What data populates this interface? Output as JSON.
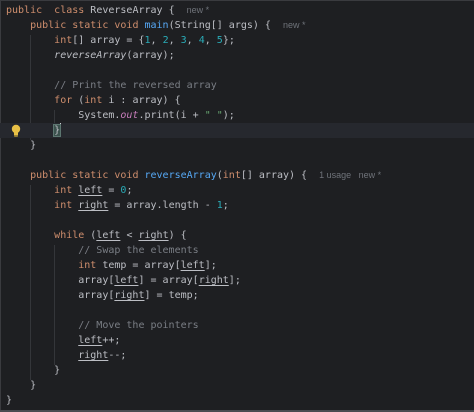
{
  "editor": {
    "background": "#1e1f22",
    "lines": [
      [
        [
          "kw",
          "public"
        ],
        [
          "",
          "  "
        ],
        [
          "kw",
          "class"
        ],
        [
          "",
          " ReverseArray {  "
        ],
        [
          "hint",
          "new *"
        ]
      ],
      [
        [
          "",
          "    "
        ],
        [
          "kw",
          "public static void"
        ],
        [
          "",
          " "
        ],
        [
          "fn",
          "main"
        ],
        [
          "",
          "(String[] args) {  "
        ],
        [
          "hint",
          "new *"
        ]
      ],
      [
        [
          "",
          "        "
        ],
        [
          "kw",
          "int"
        ],
        [
          "",
          "[] array = {"
        ],
        [
          "num",
          "1"
        ],
        [
          ", ",
          ", "
        ],
        [
          "num",
          "2"
        ],
        [
          ", ",
          ", "
        ],
        [
          "num",
          "3"
        ],
        [
          ", ",
          ", "
        ],
        [
          "num",
          "4"
        ],
        [
          ", ",
          ", "
        ],
        [
          "num",
          "5"
        ],
        [
          "",
          "};"
        ]
      ],
      [
        [
          "",
          "        "
        ],
        [
          "it",
          "reverseArray"
        ],
        [
          "",
          "(array);"
        ]
      ],
      [
        [
          "",
          ""
        ]
      ],
      [
        [
          "",
          "        "
        ],
        [
          "cm",
          "// Print the reversed array"
        ]
      ],
      [
        [
          "",
          "        "
        ],
        [
          "kw",
          "for"
        ],
        [
          "",
          " ("
        ],
        [
          "kw",
          "int"
        ],
        [
          "",
          " i : array) {"
        ]
      ],
      [
        [
          "",
          "            System."
        ],
        [
          "st",
          "out"
        ],
        [
          "",
          ".print(i + "
        ],
        [
          "str",
          "\" \""
        ],
        [
          "",
          ");"
        ]
      ],
      [
        [
          "",
          "        "
        ],
        [
          "bm",
          "}"
        ]
      ],
      [
        [
          "",
          "    }"
        ]
      ],
      [
        [
          "",
          ""
        ]
      ],
      [
        [
          "",
          "    "
        ],
        [
          "kw",
          "public static void"
        ],
        [
          "",
          " "
        ],
        [
          "fn",
          "reverseArray"
        ],
        [
          "",
          "("
        ],
        [
          "kw",
          "int"
        ],
        [
          "",
          "[] array) {  "
        ],
        [
          "hint",
          "1 usage   new *"
        ]
      ],
      [
        [
          "",
          "        "
        ],
        [
          "kw",
          "int"
        ],
        [
          "",
          " "
        ],
        [
          "ul",
          "left"
        ],
        [
          "",
          " = "
        ],
        [
          "num",
          "0"
        ],
        [
          "",
          ";"
        ]
      ],
      [
        [
          "",
          "        "
        ],
        [
          "kw",
          "int"
        ],
        [
          "",
          " "
        ],
        [
          "ul",
          "right"
        ],
        [
          "",
          " = array.length - "
        ],
        [
          "num",
          "1"
        ],
        [
          "",
          ";"
        ]
      ],
      [
        [
          "",
          ""
        ]
      ],
      [
        [
          "",
          "        "
        ],
        [
          "kw",
          "while"
        ],
        [
          "",
          " ("
        ],
        [
          "ul",
          "left"
        ],
        [
          "",
          " < "
        ],
        [
          "ul",
          "right"
        ],
        [
          "",
          ") {"
        ]
      ],
      [
        [
          "",
          "            "
        ],
        [
          "cm",
          "// Swap the elements"
        ]
      ],
      [
        [
          "",
          "            "
        ],
        [
          "kw",
          "int"
        ],
        [
          "",
          " temp = array["
        ],
        [
          "ul",
          "left"
        ],
        [
          "",
          "];"
        ]
      ],
      [
        [
          "",
          "            array["
        ],
        [
          "ul",
          "left"
        ],
        [
          "",
          "] = array["
        ],
        [
          "ul",
          "right"
        ],
        [
          "",
          "];"
        ]
      ],
      [
        [
          "",
          "            array["
        ],
        [
          "ul",
          "right"
        ],
        [
          "",
          "] = temp;"
        ]
      ],
      [
        [
          "",
          ""
        ]
      ],
      [
        [
          "",
          "            "
        ],
        [
          "cm",
          "// Move the pointers"
        ]
      ],
      [
        [
          "",
          "            "
        ],
        [
          "ul",
          "left"
        ],
        [
          "",
          "++;"
        ]
      ],
      [
        [
          "",
          "            "
        ],
        [
          "ul",
          "right"
        ],
        [
          "",
          "--;"
        ]
      ],
      [
        [
          "",
          "        }"
        ]
      ],
      [
        [
          "",
          "    }"
        ]
      ],
      [
        [
          "",
          "}"
        ]
      ]
    ],
    "highlighted_line": 8,
    "caret_line": 8,
    "gutter_icon": "lightbulb-icon"
  }
}
